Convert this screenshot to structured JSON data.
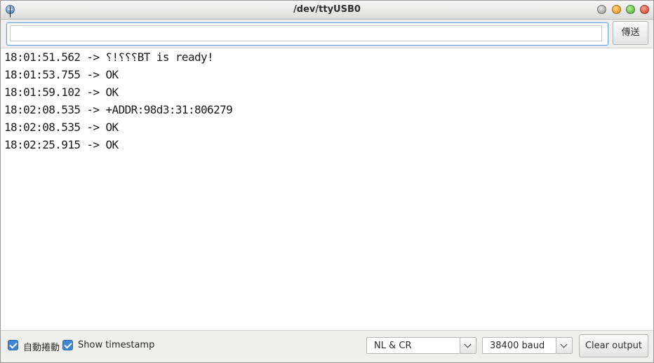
{
  "window": {
    "title": "/dev/ttyUSB0"
  },
  "send": {
    "input_value": "",
    "button_label": "傳送"
  },
  "output_lines": [
    "18:01:51.562 -> ⸮!⸮⸮⸮BT is ready!",
    "18:01:53.755 -> OK",
    "18:01:59.102 -> OK",
    "18:02:08.535 -> +ADDR:98d3:31:806279",
    "18:02:08.535 -> OK",
    "18:02:25.915 -> OK"
  ],
  "footer": {
    "autoscroll_label": "自動捲動",
    "autoscroll_checked": true,
    "timestamp_label": "Show timestamp",
    "timestamp_checked": true,
    "line_ending_selected": "NL & CR",
    "baud_selected": "38400 baud",
    "clear_label": "Clear output"
  },
  "colors": {
    "accent": "#3f86d4",
    "focus_border": "#6fa2d8"
  }
}
